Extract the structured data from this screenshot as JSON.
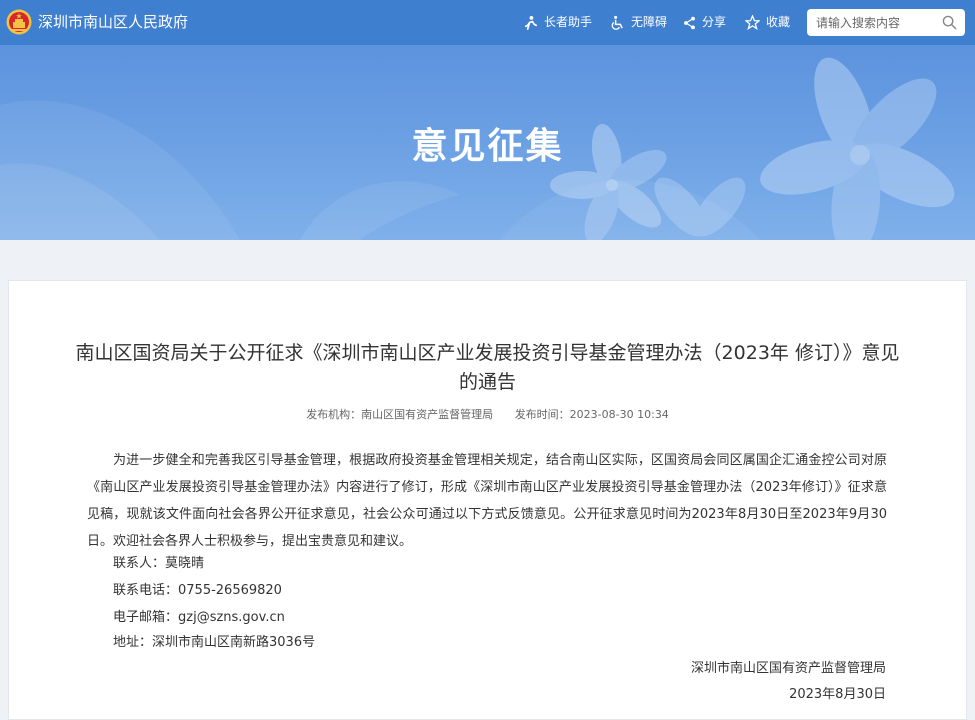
{
  "header": {
    "site_name": "深圳市南山区人民政府",
    "tools": {
      "elder": "长者助手",
      "accessibility": "无障碍",
      "share": "分享",
      "favorite": "收藏"
    },
    "search": {
      "placeholder": "请输入搜索内容",
      "value": ""
    }
  },
  "banner": {
    "title": "意见征集"
  },
  "article": {
    "title": "南山区国资局关于公开征求《深圳市南山区产业发展投资引导基金管理办法（2023年 修订）》意见的通告",
    "meta": {
      "publisher": "发布机构：南山区国有资产监督管理局",
      "publish_time": "发布时间：2023-08-30 10:34"
    },
    "body": "为进一步健全和完善我区引导基金管理，根据政府投资基金管理相关规定，结合南山区实际，区国资局会同区属国企汇通金控公司对原《南山区产业发展投资引导基金管理办法》内容进行了修订，形成《深圳市南山区产业发展投资引导基金管理办法（2023年修订）》征求意见稿，现就该文件面向社会各界公开征求意见，社会公众可通过以下方式反馈意见。公开征求意见时间为2023年8月30日至2023年9月30日。欢迎社会各界人士积极参与，提出宝贵意见和建议。",
    "contact": "联系人：莫晓晴",
    "phone": "联系电话：0755-26569820",
    "email": "电子邮箱：gzj@szns.gov.cn",
    "address": "地址：深圳市南山区南新路3036号",
    "signature_org": "深圳市南山区国有资产监督管理局",
    "signature_date": "2023年8月30日"
  },
  "colors": {
    "topbar": "#3f7fd0",
    "banner": "#6a9fe3",
    "page_bg": "#eef1f6",
    "emblem_red": "#d8262b",
    "emblem_gold": "#f3c343"
  }
}
